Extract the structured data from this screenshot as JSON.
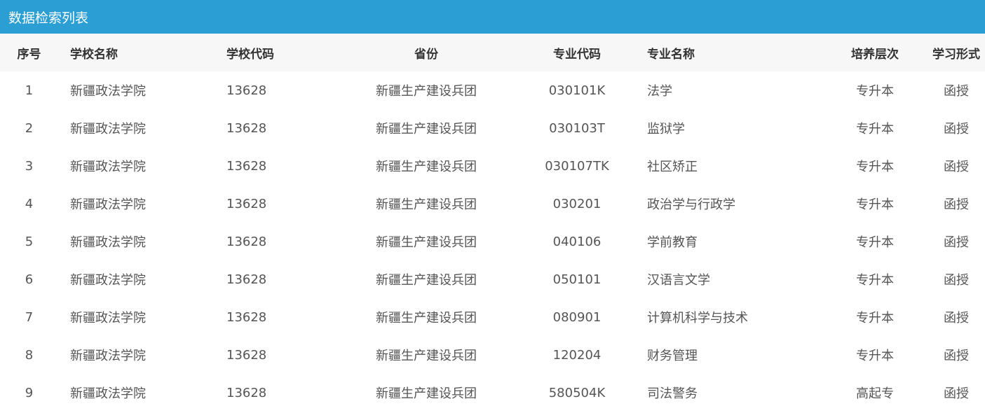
{
  "panel": {
    "title": "数据检索列表"
  },
  "table": {
    "headers": {
      "idx": "序号",
      "school": "学校名称",
      "code": "学校代码",
      "province": "省份",
      "major_code": "专业代码",
      "major_name": "专业名称",
      "level": "培养层次",
      "form": "学习形式"
    },
    "rows": [
      {
        "idx": "1",
        "school": "新疆政法学院",
        "code": "13628",
        "province": "新疆生产建设兵团",
        "major_code": "030101K",
        "major_name": "法学",
        "level": "专升本",
        "form": "函授"
      },
      {
        "idx": "2",
        "school": "新疆政法学院",
        "code": "13628",
        "province": "新疆生产建设兵团",
        "major_code": "030103T",
        "major_name": "监狱学",
        "level": "专升本",
        "form": "函授"
      },
      {
        "idx": "3",
        "school": "新疆政法学院",
        "code": "13628",
        "province": "新疆生产建设兵团",
        "major_code": "030107TK",
        "major_name": "社区矫正",
        "level": "专升本",
        "form": "函授"
      },
      {
        "idx": "4",
        "school": "新疆政法学院",
        "code": "13628",
        "province": "新疆生产建设兵团",
        "major_code": "030201",
        "major_name": "政治学与行政学",
        "level": "专升本",
        "form": "函授"
      },
      {
        "idx": "5",
        "school": "新疆政法学院",
        "code": "13628",
        "province": "新疆生产建设兵团",
        "major_code": "040106",
        "major_name": "学前教育",
        "level": "专升本",
        "form": "函授"
      },
      {
        "idx": "6",
        "school": "新疆政法学院",
        "code": "13628",
        "province": "新疆生产建设兵团",
        "major_code": "050101",
        "major_name": "汉语言文学",
        "level": "专升本",
        "form": "函授"
      },
      {
        "idx": "7",
        "school": "新疆政法学院",
        "code": "13628",
        "province": "新疆生产建设兵团",
        "major_code": "080901",
        "major_name": "计算机科学与技术",
        "level": "专升本",
        "form": "函授"
      },
      {
        "idx": "8",
        "school": "新疆政法学院",
        "code": "13628",
        "province": "新疆生产建设兵团",
        "major_code": "120204",
        "major_name": "财务管理",
        "level": "专升本",
        "form": "函授"
      },
      {
        "idx": "9",
        "school": "新疆政法学院",
        "code": "13628",
        "province": "新疆生产建设兵团",
        "major_code": "580504K",
        "major_name": "司法警务",
        "level": "高起专",
        "form": "函授"
      }
    ]
  },
  "colors": {
    "header_bg": "#2b9fd4",
    "thead_bg": "#f7f7f7"
  }
}
